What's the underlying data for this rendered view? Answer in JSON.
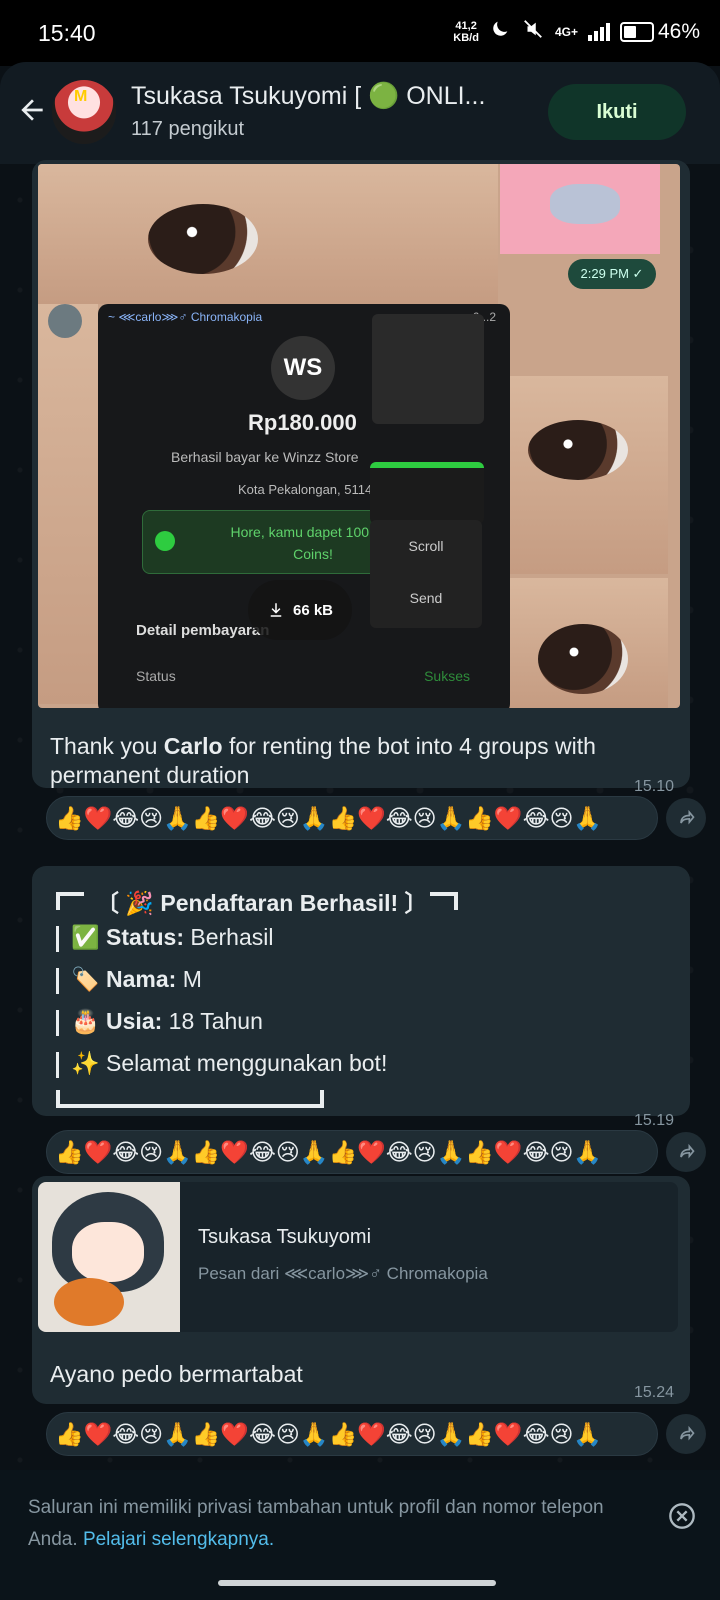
{
  "status_bar": {
    "time": "15:40",
    "net_speed_value": "41,2",
    "net_speed_unit": "KB/d",
    "network": "4G+",
    "battery": "46%",
    "battery_level": 0.46
  },
  "header": {
    "title": "Tsukasa Tsukuyomi [ 🟢 ONLI...",
    "subtitle": "117 pengikut",
    "follow_label": "Ikuti"
  },
  "messages": [
    {
      "media": {
        "receipt_header": "~ ⋘carlo⋙♂ Chromakopia",
        "receipt_header_right": "+6...2",
        "logo_text": "WS",
        "amount": "Rp180.000",
        "paid_to": "Berhasil bayar ke Winzz Store",
        "city": "Kota Pekalongan, 51141",
        "promo": "Hore, kamu dapet 100 G... Coins!",
        "menu_scroll": "Scroll",
        "menu_send": "Send",
        "download_size": "66 kB",
        "detail_label": "Detail pembayaran",
        "status_label": "Status",
        "status_value": "Sukses",
        "mini_time": "2:29 PM ✓"
      },
      "text_pre": "Thank you ",
      "text_bold": "Carlo",
      "text_post": " for renting the bot into 4 groups with permanent duration",
      "time": "15.10",
      "reactions": "👍❤️😂😢🙏👍❤️😂😢🙏👍❤️😂😢🙏👍❤️😂😢🙏"
    },
    {
      "card_title": "〔 🎉 Pendaftaran Berhasil! 〕",
      "rows": [
        {
          "emoji": "✅",
          "label": "Status:",
          "value": " Berhasil"
        },
        {
          "emoji": "🏷️",
          "label": "Nama:",
          "value": " M"
        },
        {
          "emoji": "🎂",
          "label": "Usia:",
          "value": " 18 Tahun"
        },
        {
          "emoji": "✨",
          "label": "",
          "value": " Selamat menggunakan bot!"
        }
      ],
      "time": "15.19",
      "reactions": "👍❤️😂😢🙏👍❤️😂😢🙏👍❤️😂😢🙏👍❤️😂😢🙏"
    },
    {
      "forward_name": "Tsukasa Tsukuyomi",
      "forward_from": "Pesan dari ⋘carlo⋙♂ Chromakopia",
      "text": "Ayano pedo bermartabat",
      "time": "15.24",
      "reactions": "👍❤️😂😢🙏👍❤️😂😢🙏👍❤️😂😢🙏👍❤️😂😢🙏"
    }
  ],
  "footer": {
    "notice": "Saluran ini memiliki privasi tambahan untuk profil dan nomor telepon Anda. ",
    "link": "Pelajari selengkapnya."
  },
  "colors": {
    "accent_green": "#103529",
    "link_blue": "#53bdeb",
    "bubble": "#1f2c33"
  }
}
